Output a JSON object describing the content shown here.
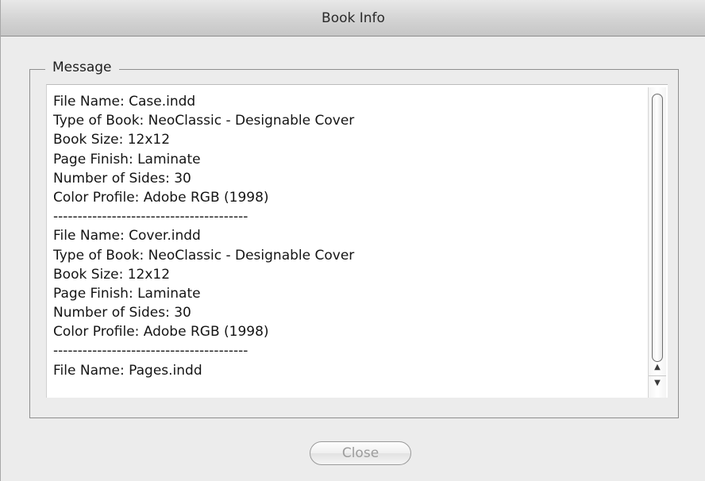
{
  "window": {
    "title": "Book Info"
  },
  "message_group": {
    "label": "Message",
    "lines": [
      "File Name: Case.indd",
      "Type of Book: NeoClassic - Designable Cover",
      "Book Size: 12x12",
      "Page Finish: Laminate",
      "Number of Sides: 30",
      "Color Profile: Adobe RGB (1998)",
      "----------------------------------------",
      "File Name: Cover.indd",
      "Type of Book: NeoClassic - Designable Cover",
      "Book Size: 12x12",
      "Page Finish: Laminate",
      "Number of Sides: 30",
      "Color Profile: Adobe RGB (1998)",
      "----------------------------------------",
      "File Name: Pages.indd"
    ]
  },
  "scrollbar": {
    "up_arrow": "▲",
    "down_arrow": "▼"
  },
  "footer": {
    "close_label": "Close"
  }
}
